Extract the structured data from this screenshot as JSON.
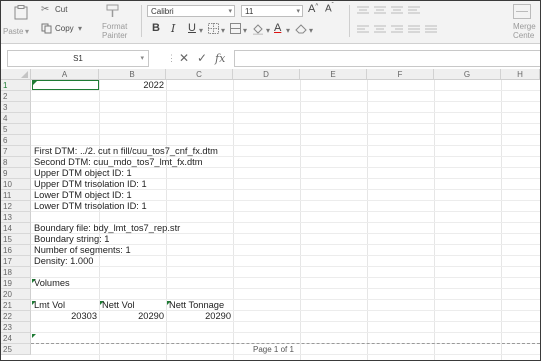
{
  "ribbon": {
    "paste_label": "Paste",
    "cut_label": "Cut",
    "copy_label": "Copy",
    "format_painter_line1": "Format",
    "format_painter_line2": "Painter",
    "font_name": "Calibri",
    "font_size": "11",
    "merge_line1": "Merge",
    "merge_line2": "Cente"
  },
  "formula_bar": {
    "name_box": "S1",
    "formula": ""
  },
  "columns": [
    "A",
    "B",
    "C",
    "D",
    "E",
    "F",
    "G",
    "H"
  ],
  "rows": [
    "1",
    "2",
    "3",
    "4",
    "5",
    "6",
    "7",
    "8",
    "9",
    "10",
    "11",
    "12",
    "13",
    "14",
    "15",
    "16",
    "17",
    "18",
    "19",
    "20",
    "21",
    "22",
    "23",
    "24",
    "25"
  ],
  "cells": {
    "b1": "2022",
    "a7": "First DTM: ../2. cut n fill/cuu_tos7_cnf_fx.dtm",
    "a8": "Second DTM: cuu_mdo_tos7_lmt_fx.dtm",
    "a9": "Upper DTM object ID: 1",
    "a10": "Upper DTM trisolation ID: 1",
    "a11": "Lower DTM object ID: 1",
    "a12": "Lower DTM trisolation ID: 1",
    "a14": "Boundary file: bdy_lmt_tos7_rep.str",
    "a15": "Boundary string: 1",
    "a16": "Number of segments: 1",
    "a17": "Density: 1.000",
    "a19": "Volumes",
    "a21": "Lmt Vol",
    "b21": "Nett Vol",
    "c21": "Nett Tonnage",
    "a22": "20303",
    "b22": "20290",
    "c22": "20290"
  },
  "page_label": "Page 1 of 1",
  "accent_color": "#1e7b34"
}
